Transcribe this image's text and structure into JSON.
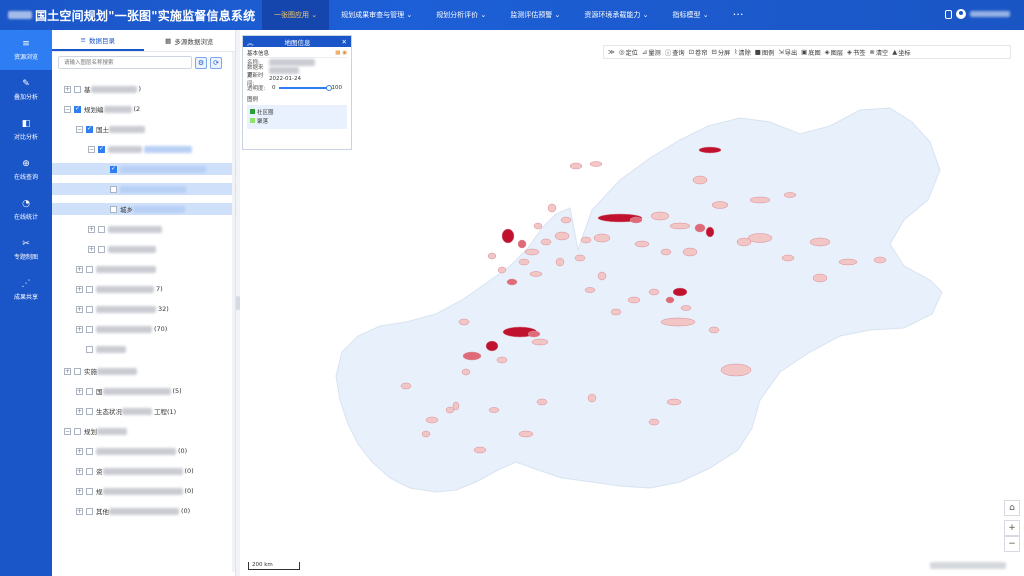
{
  "header": {
    "title": "国土空间规划\"一张图\"实施监督信息系统",
    "nav": [
      {
        "label": "一张图应用 ⌄",
        "active": true
      },
      {
        "label": "规划成果审查与管理 ⌄"
      },
      {
        "label": "规划分析评价 ⌄"
      },
      {
        "label": "监测评估预警 ⌄"
      },
      {
        "label": "资源环境承载能力 ⌄"
      },
      {
        "label": "指标模型 ⌄"
      }
    ],
    "more": "···"
  },
  "rail": [
    {
      "label": "资源浏览",
      "icon": "≡",
      "active": true
    },
    {
      "label": "叠加分析",
      "icon": "✎"
    },
    {
      "label": "对比分析",
      "icon": "◧"
    },
    {
      "label": "在线查询",
      "icon": "⊕"
    },
    {
      "label": "在线统计",
      "icon": "◔"
    },
    {
      "label": "专题制图",
      "icon": "✂"
    },
    {
      "label": "成果共享",
      "icon": "⋰"
    }
  ],
  "panel": {
    "tabs": [
      {
        "label": "数据目录",
        "icon": "≡"
      },
      {
        "label": "多源数据浏览",
        "icon": "▦"
      }
    ],
    "search_placeholder": "请输入图层名称搜索",
    "tree": [
      {
        "indent": 0,
        "exp": "+",
        "check": false,
        "text": "基",
        "blur": 46,
        "tail": ")"
      },
      {
        "indent": 0,
        "exp": "−",
        "check": true,
        "text": "规划编",
        "blur": 28,
        "tail": "(2"
      },
      {
        "indent": 1,
        "exp": "−",
        "check": true,
        "text": "国土",
        "blur": 36,
        "tail": ""
      },
      {
        "indent": 2,
        "exp": "−",
        "check": true,
        "text": "",
        "blur": 34,
        "tail": "",
        "blueBar": 48
      },
      {
        "indent": 3,
        "exp": "",
        "check": true,
        "text": "",
        "blur": 86,
        "tail": "",
        "sel": true
      },
      {
        "indent": 3,
        "exp": "",
        "check": false,
        "text": "",
        "blur": 66,
        "tail": "",
        "sel": true
      },
      {
        "indent": 3,
        "exp": "",
        "check": false,
        "text": "城乡",
        "blur": 52,
        "tail": "",
        "sel": true
      },
      {
        "indent": 2,
        "exp": "+",
        "check": false,
        "text": "",
        "blur": 54,
        "tail": ""
      },
      {
        "indent": 2,
        "exp": "+",
        "check": false,
        "text": "",
        "blur": 48,
        "tail": ""
      },
      {
        "indent": 1,
        "exp": "+",
        "check": false,
        "text": "",
        "blur": 60,
        "tail": ""
      },
      {
        "indent": 1,
        "exp": "+",
        "check": false,
        "text": "",
        "blur": 58,
        "tail": "7)"
      },
      {
        "indent": 1,
        "exp": "+",
        "check": false,
        "text": "",
        "blur": 60,
        "tail": "32)"
      },
      {
        "indent": 1,
        "exp": "+",
        "check": false,
        "text": "",
        "blur": 56,
        "tail": "(70)"
      },
      {
        "indent": 1,
        "exp": "",
        "check": false,
        "text": "",
        "blur": 30,
        "tail": ""
      },
      {
        "indent": 0,
        "exp": "+",
        "check": false,
        "text": "实施",
        "blur": 40,
        "tail": ""
      },
      {
        "indent": 1,
        "exp": "+",
        "check": false,
        "text": "国",
        "blur": 68,
        "tail": "(5)"
      },
      {
        "indent": 1,
        "exp": "+",
        "check": false,
        "text": "生态状况",
        "blur": 30,
        "tail": "工程(1)"
      },
      {
        "indent": 0,
        "exp": "−",
        "check": false,
        "text": "规划",
        "blur": 30,
        "tail": ""
      },
      {
        "indent": 1,
        "exp": "+",
        "check": false,
        "text": "",
        "blur": 80,
        "tail": "(0)"
      },
      {
        "indent": 1,
        "exp": "+",
        "check": false,
        "text": "资",
        "blur": 80,
        "tail": "(0)"
      },
      {
        "indent": 1,
        "exp": "+",
        "check": false,
        "text": "规",
        "blur": 80,
        "tail": "(0)"
      },
      {
        "indent": 1,
        "exp": "+",
        "check": false,
        "text": "其他",
        "blur": 70,
        "tail": "(0)"
      }
    ]
  },
  "toolbar": [
    {
      "icon": "◎",
      "label": "定位"
    },
    {
      "icon": "⊿",
      "label": "量测"
    },
    {
      "icon": "ⓘ",
      "label": "查询"
    },
    {
      "icon": "⊡",
      "label": "卷帘"
    },
    {
      "icon": "⊟",
      "label": "分屏"
    },
    {
      "icon": "⌇",
      "label": "清除"
    },
    {
      "icon": "■",
      "label": "图例"
    },
    {
      "icon": "⇲",
      "label": "导出"
    },
    {
      "icon": "▣",
      "label": "底图"
    },
    {
      "icon": "◈",
      "label": "图层"
    },
    {
      "icon": "◈",
      "label": "书签"
    },
    {
      "icon": "⊗",
      "label": "清空"
    },
    {
      "icon": "▲",
      "label": "坐标"
    }
  ],
  "info": {
    "title": "地图信息",
    "section": "基本信息",
    "name_label": "名称:",
    "source_label": "数据来源:",
    "update_label": "更新时间:",
    "update_value": "2022-01-24",
    "opacity_label": "透明度:",
    "opacity_min": "0",
    "opacity_max": "100",
    "legend_title": "图例",
    "legend": [
      {
        "label": "社区圈",
        "color": "#2a9d3a"
      },
      {
        "label": "聚落",
        "color": "#8ee36b"
      }
    ]
  },
  "map": {
    "scale_label": "200 km",
    "controls": [
      "⌂",
      "+",
      "−"
    ]
  },
  "colors": {
    "brand": "#1b56c8",
    "land": "#e8f1fb",
    "patch_light": "#f3c6c6",
    "patch_mid": "#e06b78",
    "patch_dark": "#c0112f"
  }
}
